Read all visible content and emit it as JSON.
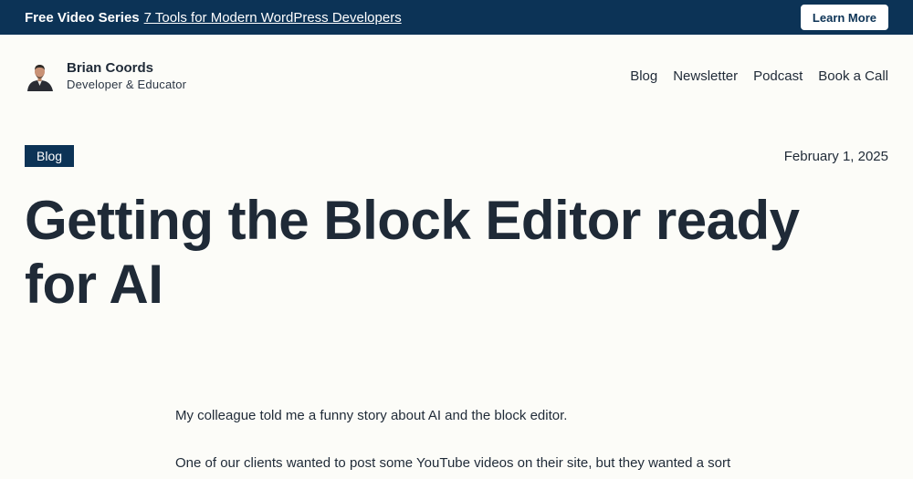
{
  "promo": {
    "label": "Free Video Series",
    "link_text": "7 Tools for Modern WordPress Developers",
    "button_label": "Learn More"
  },
  "header": {
    "name": "Brian Coords",
    "tagline": "Developer & Educator",
    "avatar_icon": "person-avatar-icon",
    "nav": [
      "Blog",
      "Newsletter",
      "Podcast",
      "Book a Call"
    ]
  },
  "post": {
    "category": "Blog",
    "date": "February 1, 2025",
    "title": "Getting the Block Editor ready for AI",
    "paragraphs": [
      "My colleague told me a funny story about AI and the block editor.",
      "One of our clients wanted to post some YouTube videos on their site, but they wanted a sort of carousel, one video in the hero section with the option to click thumbnails"
    ]
  },
  "colors": {
    "brand_navy": "#0c3356",
    "text": "#1f2a37",
    "background": "#fcfcf8"
  }
}
